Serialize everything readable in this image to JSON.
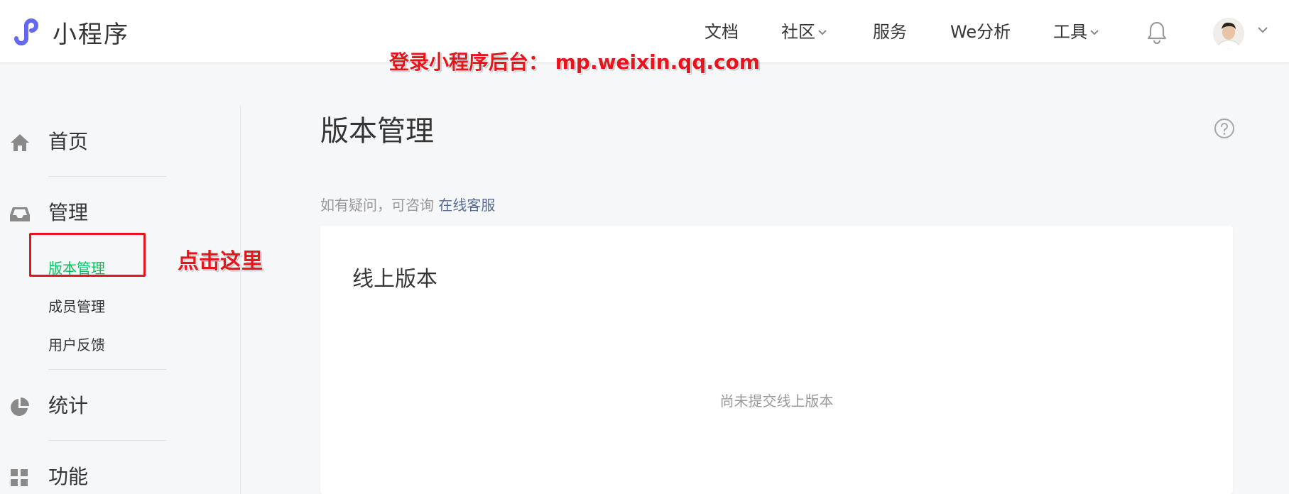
{
  "header": {
    "brand": "小程序",
    "nav": [
      {
        "label": "文档",
        "dropdown": false
      },
      {
        "label": "社区",
        "dropdown": true
      },
      {
        "label": "服务",
        "dropdown": false
      },
      {
        "label": "We分析",
        "dropdown": false
      },
      {
        "label": "工具",
        "dropdown": true
      }
    ],
    "icons": {
      "logo": "miniprogram-logo-icon",
      "bell": "bell-icon",
      "caret": "chevron-down-icon"
    }
  },
  "annotations": {
    "top": "登录小程序后台： mp.weixin.qq.com",
    "click_here": "点击这里"
  },
  "sidebar": {
    "sections": [
      {
        "label": "首页",
        "icon": "home-icon"
      },
      {
        "label": "管理",
        "icon": "inbox-icon",
        "items": [
          "版本管理",
          "成员管理",
          "用户反馈"
        ],
        "active": "版本管理"
      },
      {
        "label": "统计",
        "icon": "pie-chart-icon"
      },
      {
        "label": "功能",
        "icon": "grid-icon"
      }
    ]
  },
  "main": {
    "title": "版本管理",
    "consult_prefix": "如有疑问，可咨询",
    "consult_link": "在线客服",
    "card": {
      "title": "线上版本",
      "empty_text": "尚未提交线上版本"
    }
  },
  "colors": {
    "accent_green": "#07c160",
    "link_blue": "#576b95",
    "annotation_red": "#e8141b",
    "logo_purple": "#6467f0"
  }
}
